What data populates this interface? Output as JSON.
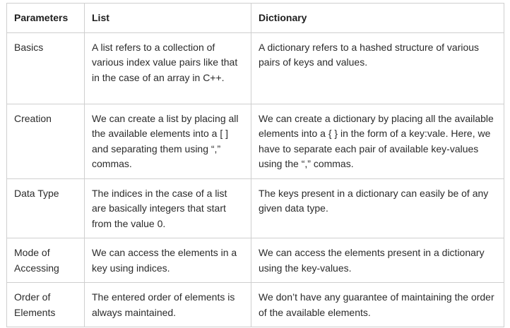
{
  "table": {
    "headers": [
      "Parameters",
      "List",
      "Dictionary"
    ],
    "rows": [
      {
        "parameter": "Basics",
        "list": "A list refers to a collection of various index value pairs like that in the case of an array in C++.",
        "dictionary": "A dictionary refers to a hashed structure of various pairs of keys and values."
      },
      {
        "parameter": "Creation",
        "list": "We can create a list by placing all the available elements into a [ ] and separating them using “,” commas.",
        "dictionary": "We can create a dictionary by placing all the available elements into a { } in the form of a key:vale. Here, we have to separate each pair of available key-values using the “,” commas."
      },
      {
        "parameter": "Data Type",
        "list": "The indices in the case of a list are basically integers that start from the value 0.",
        "dictionary": "The keys present in a dictionary can easily be of any given data type."
      },
      {
        "parameter": "Mode of Accessing",
        "list": "We can access the elements in a key using indices.",
        "dictionary": "We can access the elements present in a dictionary using the key-values."
      },
      {
        "parameter": "Order of Elements",
        "list": "The entered order of elements is always maintained.",
        "dictionary": "We don’t have any guarantee of maintaining the order of the available elements."
      }
    ]
  }
}
